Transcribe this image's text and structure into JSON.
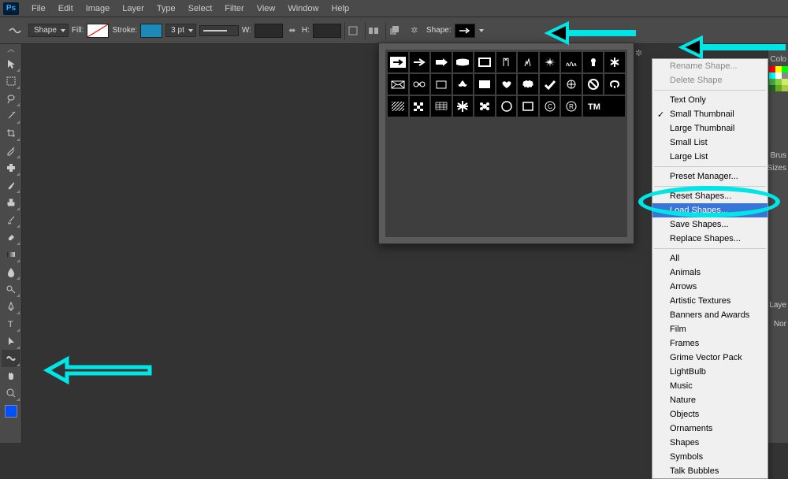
{
  "app": {
    "logo": "Ps"
  },
  "menu": [
    "File",
    "Edit",
    "Image",
    "Layer",
    "Type",
    "Select",
    "Filter",
    "View",
    "Window",
    "Help"
  ],
  "options": {
    "mode": "Shape",
    "fill_label": "Fill:",
    "stroke_label": "Stroke:",
    "stroke_pt": "3 pt",
    "w_label": "W:",
    "h_label": "H:",
    "shape_label": "Shape:"
  },
  "context_menu": {
    "rename": "Rename Shape...",
    "delete": "Delete Shape",
    "text_only": "Text Only",
    "small_thumb": "Small Thumbnail",
    "large_thumb": "Large Thumbnail",
    "small_list": "Small List",
    "large_list": "Large List",
    "preset_mgr": "Preset Manager...",
    "reset_shapes": "Reset Shapes...",
    "load_shapes": "Load Shapes...",
    "save_shapes": "Save Shapes...",
    "replace_shapes": "Replace Shapes...",
    "presets": [
      "All",
      "Animals",
      "Arrows",
      "Artistic Textures",
      "Banners and Awards",
      "Film",
      "Frames",
      "Grime Vector Pack",
      "LightBulb",
      "Music",
      "Nature",
      "Objects",
      "Ornaments",
      "Shapes",
      "Symbols",
      "Talk Bubbles"
    ]
  },
  "right_panels": {
    "color": "Colo",
    "brush": "Brus",
    "sizes": "Sizes",
    "layers": "Laye",
    "normal": "Nor"
  }
}
